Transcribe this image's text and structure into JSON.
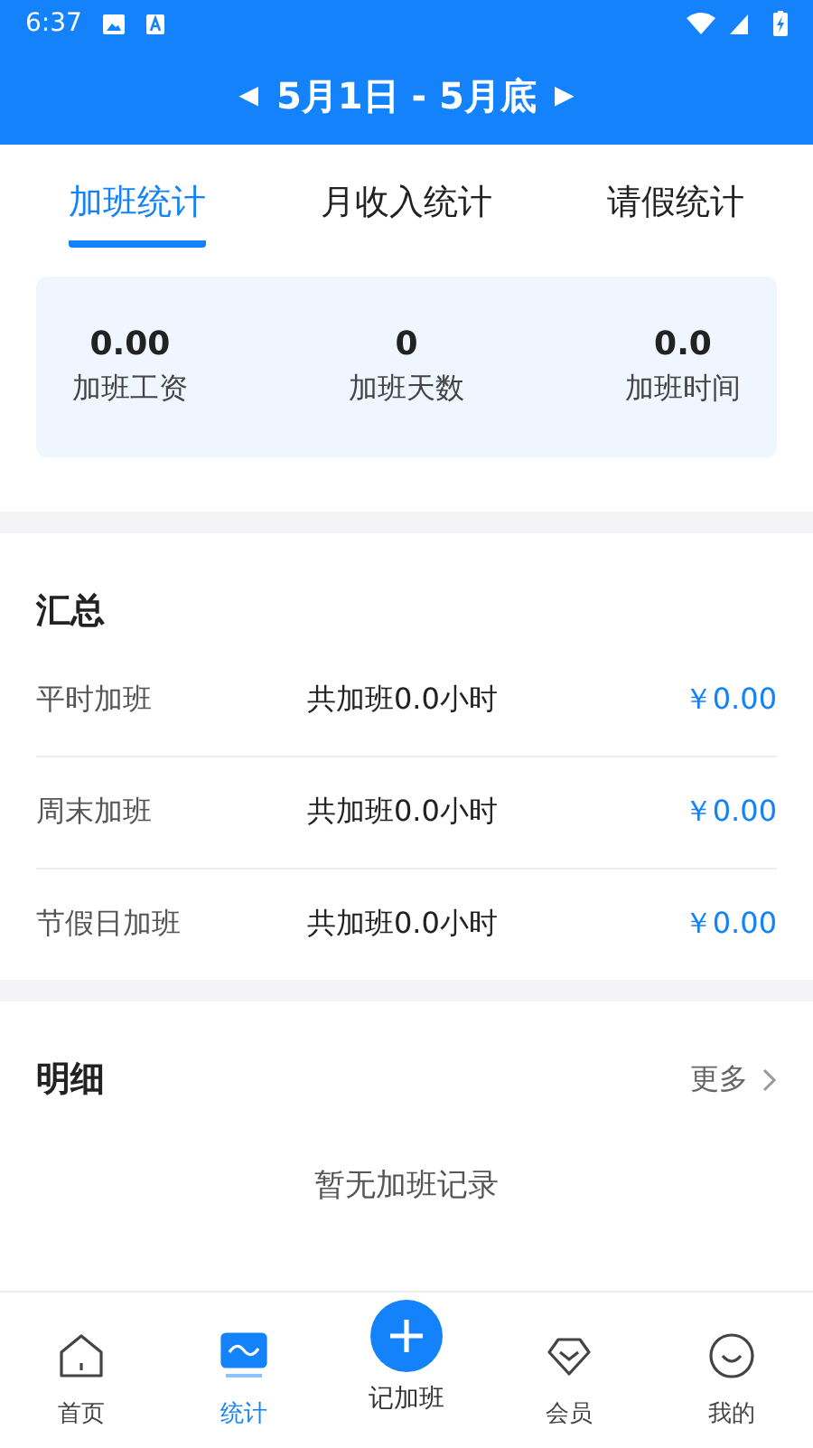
{
  "status_bar": {
    "time": "6:37"
  },
  "header": {
    "prev": "◀",
    "title": "5月1日 - 5月底",
    "next": "▶"
  },
  "tabs": [
    {
      "label": "加班统计",
      "selected": true
    },
    {
      "label": "月收入统计",
      "selected": false
    },
    {
      "label": "请假统计",
      "selected": false
    }
  ],
  "stats": [
    {
      "value": "0.00",
      "label": "加班工资"
    },
    {
      "value": "0",
      "label": "加班天数"
    },
    {
      "value": "0.0",
      "label": "加班时间"
    }
  ],
  "summary": {
    "title": "汇总",
    "rows": [
      {
        "name": "平时加班",
        "hours": "共加班0.0小时",
        "amount": "￥0.00"
      },
      {
        "name": "周末加班",
        "hours": "共加班0.0小时",
        "amount": "￥0.00"
      },
      {
        "name": "节假日加班",
        "hours": "共加班0.0小时",
        "amount": "￥0.00"
      }
    ]
  },
  "detail": {
    "title": "明细",
    "more": "更多",
    "empty": "暂无加班记录"
  },
  "nav": [
    {
      "kind": "tab",
      "label": "首页",
      "selected": false
    },
    {
      "kind": "tab",
      "label": "统计",
      "selected": true
    },
    {
      "kind": "action",
      "label": "记加班"
    },
    {
      "kind": "tab",
      "label": "会员",
      "selected": false
    },
    {
      "kind": "tab",
      "label": "我的",
      "selected": false
    }
  ]
}
